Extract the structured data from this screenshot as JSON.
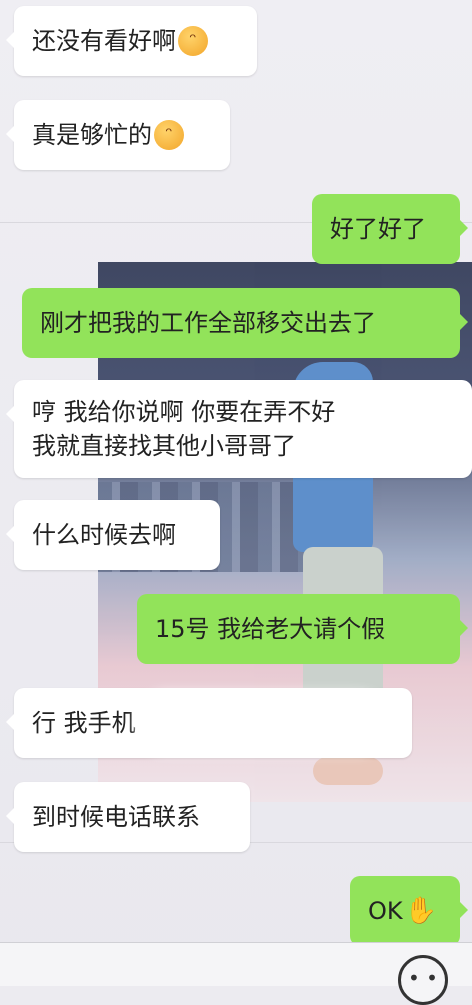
{
  "messages": [
    {
      "side": "in",
      "text": "还没有看好啊",
      "emoji": "😠"
    },
    {
      "side": "in",
      "text": "真是够忙的",
      "emoji": "😠"
    },
    {
      "side": "out",
      "text": "好了好了"
    },
    {
      "side": "out",
      "text": "刚才把我的工作全部移交出去了"
    },
    {
      "side": "in",
      "line1": "哼  我给你说啊  你要在弄不好",
      "line2": "我就直接找其他小哥哥了"
    },
    {
      "side": "in",
      "text": "什么时候去啊"
    },
    {
      "side": "out",
      "text": "15号  我给老大请个假"
    },
    {
      "side": "in",
      "text": "行  我手机"
    },
    {
      "side": "in",
      "text": "到时候电话联系"
    },
    {
      "side": "out",
      "text": "OK",
      "emoji": "👌"
    }
  ],
  "input_bar": {
    "emoji_button_icon": "smiley-icon"
  },
  "colors": {
    "outgoing_bubble": "#92e35a",
    "incoming_bubble": "#ffffff",
    "background": "#ecebf0"
  }
}
